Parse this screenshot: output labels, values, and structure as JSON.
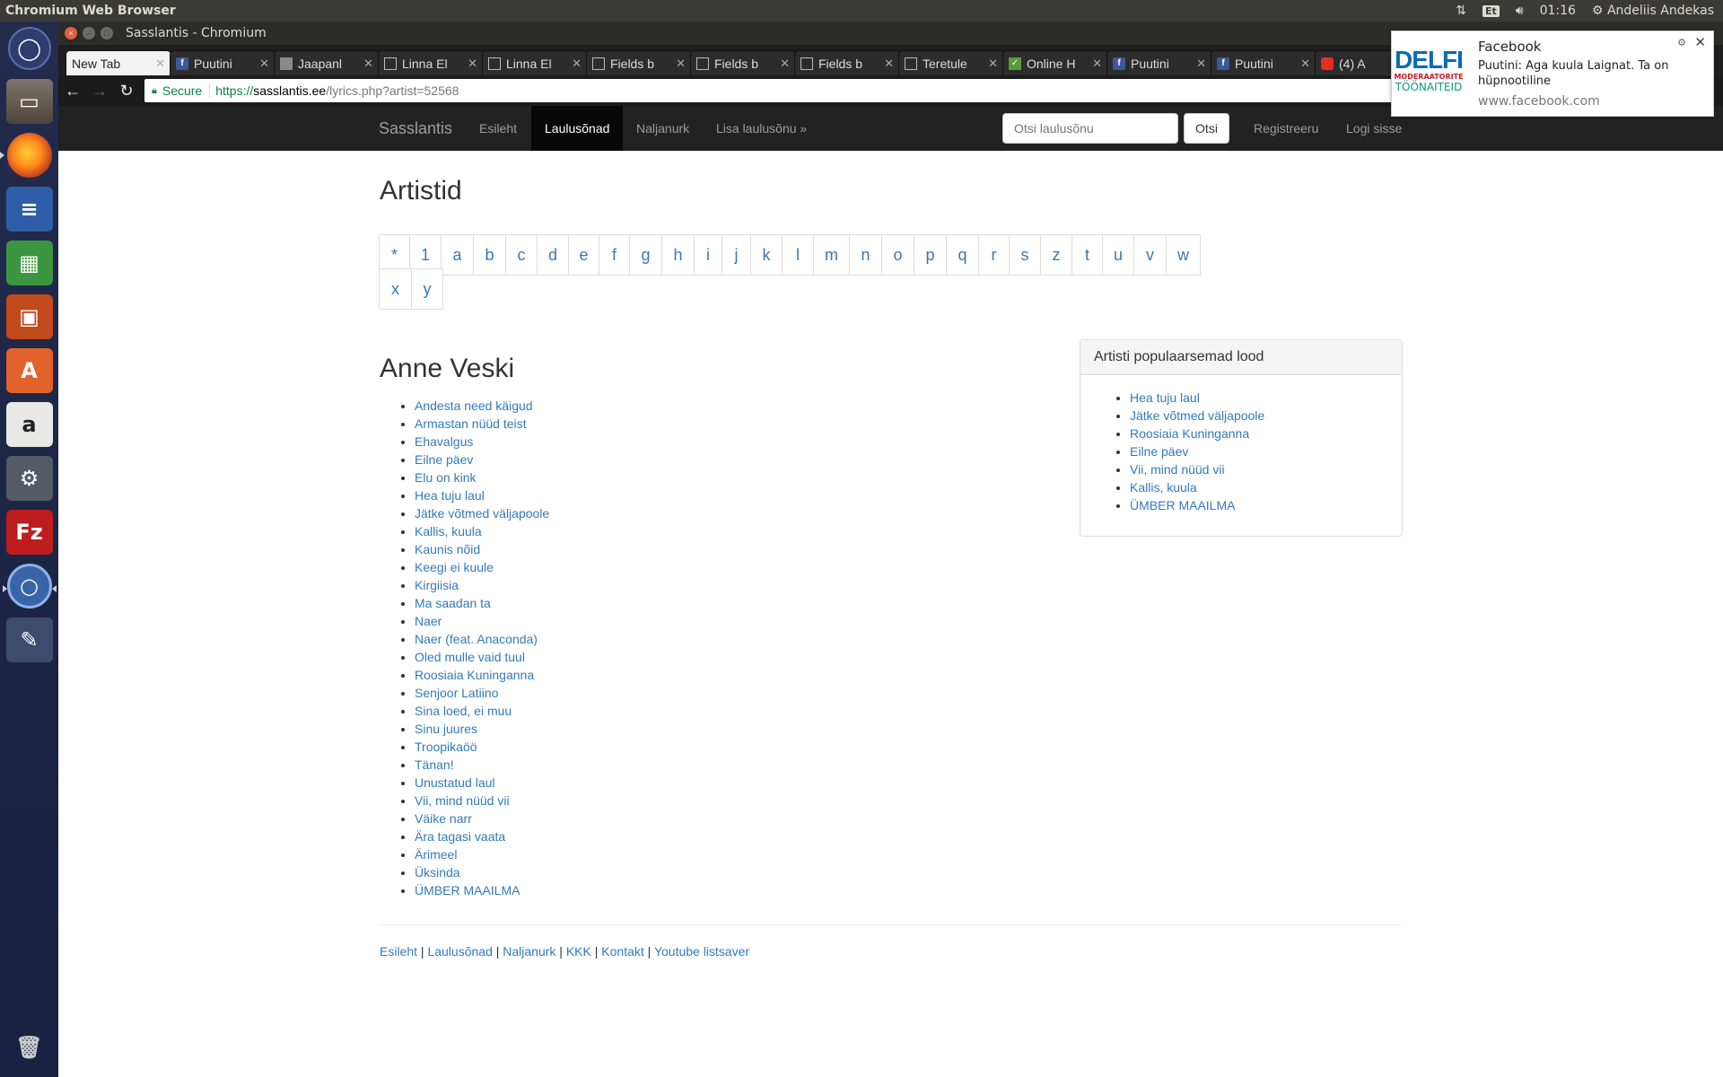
{
  "panel": {
    "app_title": "Chromium Web Browser",
    "keyboard_layout": "Et",
    "clock": "01:16",
    "user": "Andeliis Andekas"
  },
  "window": {
    "title": "Sasslantis - Chromium"
  },
  "tabs": [
    {
      "label": "New Tab",
      "icon": "none"
    },
    {
      "label": "Puutini",
      "icon": "facebook-icon"
    },
    {
      "label": "Jaapanl",
      "icon": "grey-page-icon"
    },
    {
      "label": "Linna El",
      "icon": "document-icon"
    },
    {
      "label": "Linna El",
      "icon": "document-icon"
    },
    {
      "label": "Fields b",
      "icon": "document-icon"
    },
    {
      "label": "Fields b",
      "icon": "document-icon"
    },
    {
      "label": "Fields b",
      "icon": "document-icon"
    },
    {
      "label": "Teretule",
      "icon": "document-icon"
    },
    {
      "label": "Online H",
      "icon": "green-icon"
    },
    {
      "label": "Puutini",
      "icon": "facebook-icon"
    },
    {
      "label": "Puutini",
      "icon": "facebook-icon"
    },
    {
      "label": "(4) A",
      "icon": "youtube-icon"
    }
  ],
  "address": {
    "secure_label": "Secure",
    "scheme": "https://",
    "host": "sasslantis.ee",
    "path": "/lyrics.php?artist=52568"
  },
  "site": {
    "brand": "Sasslantis",
    "nav": {
      "home": "Esileht",
      "lyrics": "Laulusõnad",
      "jokes": "Naljanurk",
      "add": "Lisa laulusõnu »"
    },
    "search_placeholder": "Otsi laulusõnu",
    "search_button": "Otsi",
    "register": "Registreeru",
    "login": "Logi sisse"
  },
  "main": {
    "title": "Artistid",
    "letters": [
      "*",
      "1",
      "a",
      "b",
      "c",
      "d",
      "e",
      "f",
      "g",
      "h",
      "i",
      "j",
      "k",
      "l",
      "m",
      "n",
      "o",
      "p",
      "q",
      "r",
      "s",
      "z",
      "t",
      "u",
      "v",
      "w",
      "x",
      "y"
    ],
    "artist": "Anne Veski",
    "songs": [
      "Andesta need käigud",
      "Armastan nüüd teist",
      "Ehavalgus",
      "Eilne päev",
      "Elu on kink",
      "Hea tuju laul",
      "Jätke võtmed väljapoole",
      "Kallis, kuula",
      "Kaunis nõid",
      "Keegi ei kuule",
      "Kirgiisia",
      "Ma saadan ta",
      "Naer",
      "Naer (feat. Anaconda)",
      "Oled mulle vaid tuul",
      "Roosiaia Kuninganna",
      "Senjoor Latiino",
      "Sina loed, ei muu",
      "Sinu juures",
      "Troopikaöö",
      "Tänan!",
      "Unustatud laul",
      "Vii, mind nüüd vii",
      "Väike narr",
      "Ära tagasi vaata",
      "Ärimeel",
      "Üksinda",
      "ÜMBER MAAILMA"
    ]
  },
  "popular": {
    "heading": "Artisti populaarsemad lood",
    "songs": [
      "Hea tuju laul",
      "Jätke võtmed väljapoole",
      "Roosiaia Kuninganna",
      "Eilne päev",
      "Vii, mind nüüd vii",
      "Kallis, kuula",
      "ÜMBER MAAILMA"
    ]
  },
  "footer": {
    "links": [
      "Esileht",
      "Laulusõnad",
      "Naljanurk",
      "KKK",
      "Kontakt",
      "Youtube listsaver"
    ],
    "separator": " | "
  },
  "notification": {
    "logo_text": "DELFI",
    "logo_line1": "MODERAATORITE",
    "logo_line2": "TÖÖNAITEID",
    "title": "Facebook",
    "body": "Puutini: Aga kuula Laignat. Ta on hüpnootiline",
    "site": "www.facebook.com"
  }
}
